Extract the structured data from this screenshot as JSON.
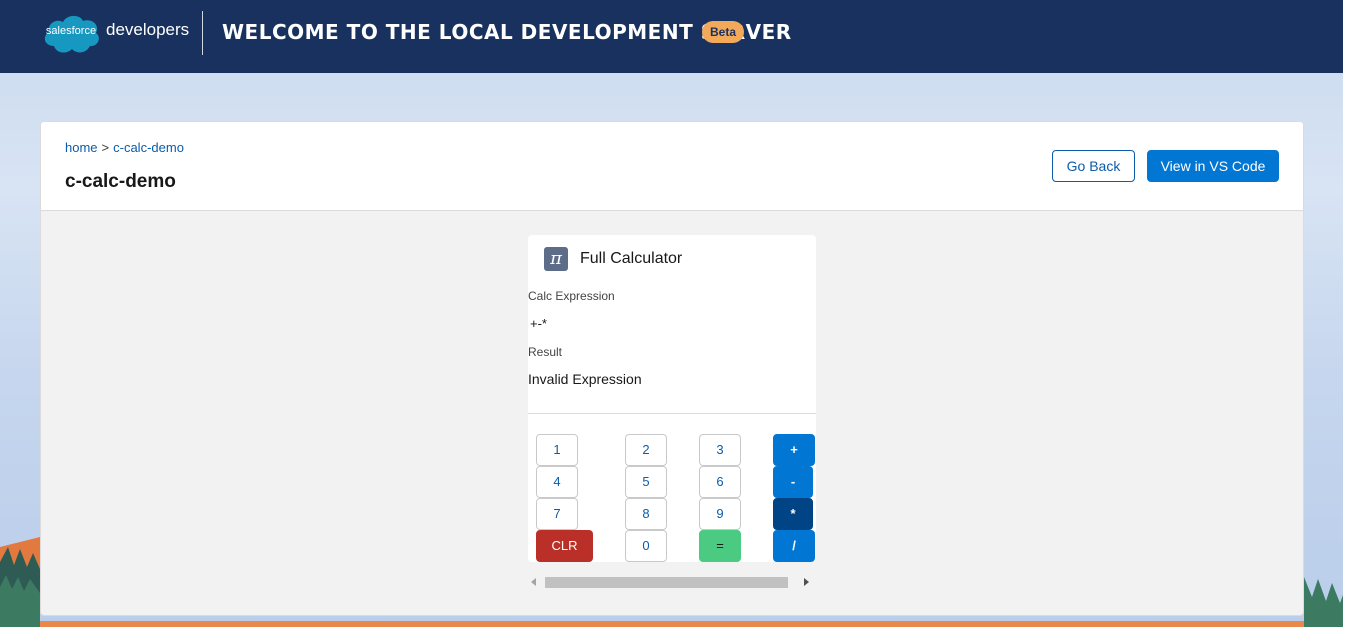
{
  "header": {
    "logo_cloud_text": "salesforce",
    "logo_developers_text": "developers",
    "title": "WELCOME TO THE LOCAL DEVELOPMENT SERVER",
    "badge": "Beta"
  },
  "breadcrumb": {
    "home": "home",
    "separator": ">",
    "current": "c-calc-demo"
  },
  "page": {
    "title": "c-calc-demo",
    "go_back": "Go Back",
    "view_vs_code": "View in VS Code"
  },
  "calculator": {
    "icon_glyph": "π",
    "title": "Full Calculator",
    "expression_label": "Calc Expression",
    "expression_value": "+-*",
    "result_label": "Result",
    "result_value": "Invalid Expression",
    "keys": {
      "k1": "1",
      "k2": "2",
      "k3": "3",
      "plus": "+",
      "k4": "4",
      "k5": "5",
      "k6": "6",
      "minus": "-",
      "k7": "7",
      "k8": "8",
      "k9": "9",
      "mult": "*",
      "clr": "CLR",
      "k0": "0",
      "eq": "=",
      "div": "/"
    }
  },
  "colors": {
    "header_bg": "#18315f",
    "brand_blue": "#0176d3",
    "clr_red": "#ba2f27",
    "eq_green": "#4bca81",
    "badge_orange": "#f3a95a"
  }
}
